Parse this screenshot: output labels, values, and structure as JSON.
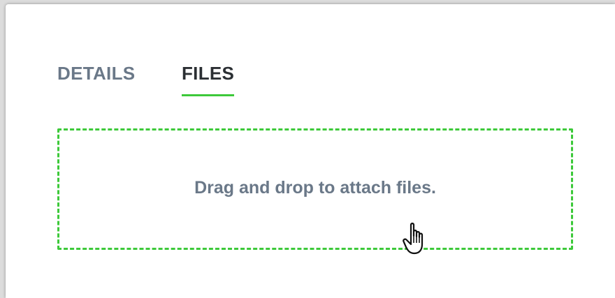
{
  "tabs": [
    {
      "label": "DETAILS",
      "active": false
    },
    {
      "label": "FILES",
      "active": true
    }
  ],
  "dropzone": {
    "message": "Drag and drop to attach files."
  },
  "colors": {
    "accent": "#3dc93a",
    "inactive_tab": "#6a7888",
    "active_tab": "#2b2f33"
  },
  "icons": {
    "cursor": "hand-pointer-icon"
  }
}
